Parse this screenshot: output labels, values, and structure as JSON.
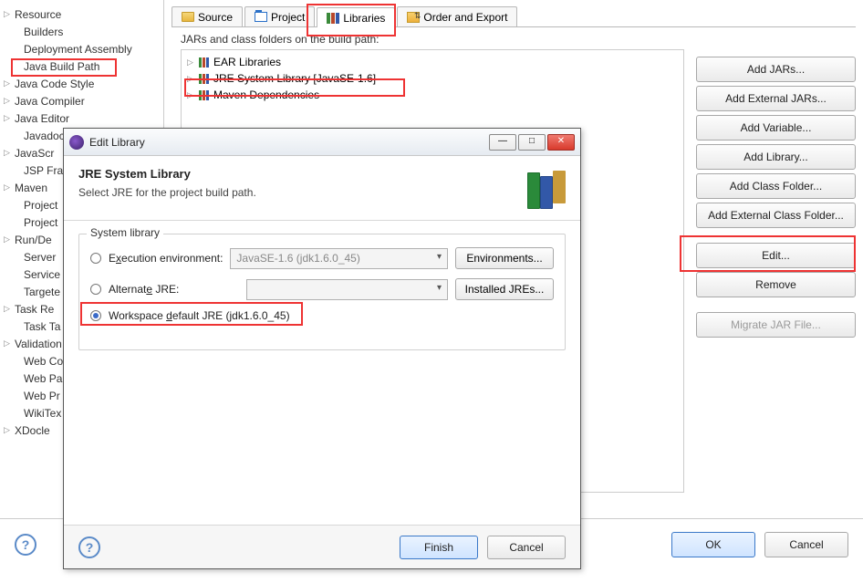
{
  "left_tree": {
    "items": [
      {
        "label": "Resource",
        "arrow": true,
        "indent": 0
      },
      {
        "label": "Builders",
        "arrow": false,
        "indent": 1
      },
      {
        "label": "Deployment Assembly",
        "arrow": false,
        "indent": 1
      },
      {
        "label": "Java Build Path",
        "arrow": false,
        "indent": 1
      },
      {
        "label": "Java Code Style",
        "arrow": true,
        "indent": 0
      },
      {
        "label": "Java Compiler",
        "arrow": true,
        "indent": 0
      },
      {
        "label": "Java Editor",
        "arrow": true,
        "indent": 0
      },
      {
        "label": "Javadoc",
        "arrow": false,
        "indent": 1
      },
      {
        "label": "JavaScr",
        "arrow": true,
        "indent": 0
      },
      {
        "label": "JSP Fra",
        "arrow": false,
        "indent": 1
      },
      {
        "label": "Maven",
        "arrow": true,
        "indent": 0
      },
      {
        "label": "Project",
        "arrow": false,
        "indent": 1
      },
      {
        "label": "Project",
        "arrow": false,
        "indent": 1
      },
      {
        "label": "Run/De",
        "arrow": true,
        "indent": 0
      },
      {
        "label": "Server",
        "arrow": false,
        "indent": 1
      },
      {
        "label": "Service",
        "arrow": false,
        "indent": 1
      },
      {
        "label": "Targete",
        "arrow": false,
        "indent": 1
      },
      {
        "label": "Task Re",
        "arrow": true,
        "indent": 0
      },
      {
        "label": "Task Ta",
        "arrow": false,
        "indent": 1
      },
      {
        "label": "Validation",
        "arrow": true,
        "indent": 0
      },
      {
        "label": "Web Co",
        "arrow": false,
        "indent": 1
      },
      {
        "label": "Web Pa",
        "arrow": false,
        "indent": 1
      },
      {
        "label": "Web Pr",
        "arrow": false,
        "indent": 1
      },
      {
        "label": "WikiTex",
        "arrow": false,
        "indent": 1
      },
      {
        "label": "XDocle",
        "arrow": true,
        "indent": 0
      }
    ]
  },
  "tabs": {
    "source": "Source",
    "projects": "Project",
    "libraries": "Libraries",
    "order": "Order and Export"
  },
  "bp": {
    "desc": "JARs and class folders on the build path:",
    "items": [
      "EAR Libraries",
      "JRE System Library [JavaSE-1.6]",
      "Maven Dependencies"
    ]
  },
  "side_buttons": {
    "add_jars": "Add JARs...",
    "add_ext_jars": "Add External JARs...",
    "add_variable": "Add Variable...",
    "add_library": "Add Library...",
    "add_class_folder": "Add Class Folder...",
    "add_ext_class_folder": "Add External Class Folder...",
    "edit": "Edit...",
    "remove": "Remove",
    "migrate": "Migrate JAR File..."
  },
  "bottom": {
    "ok": "OK",
    "cancel": "Cancel"
  },
  "dialog": {
    "title": "Edit Library",
    "heading": "JRE System Library",
    "subheading": "Select JRE for the project build path.",
    "group_label": "System library",
    "exec_env_label_pre": "E",
    "exec_env_label_ul": "x",
    "exec_env_label_post": "ecution environment:",
    "exec_env_value": "JavaSE-1.6 (jdk1.6.0_45)",
    "environments_btn": "Environments...",
    "alt_jre_label_pre": "Alternat",
    "alt_jre_label_ul": "e",
    "alt_jre_label_post": " JRE:",
    "installed_jres_btn": "Installed JREs...",
    "workspace_label_pre": "Workspace ",
    "workspace_label_ul": "d",
    "workspace_label_post": "efault JRE (jdk1.6.0_45)",
    "finish": "Finish",
    "cancel": "Cancel"
  }
}
